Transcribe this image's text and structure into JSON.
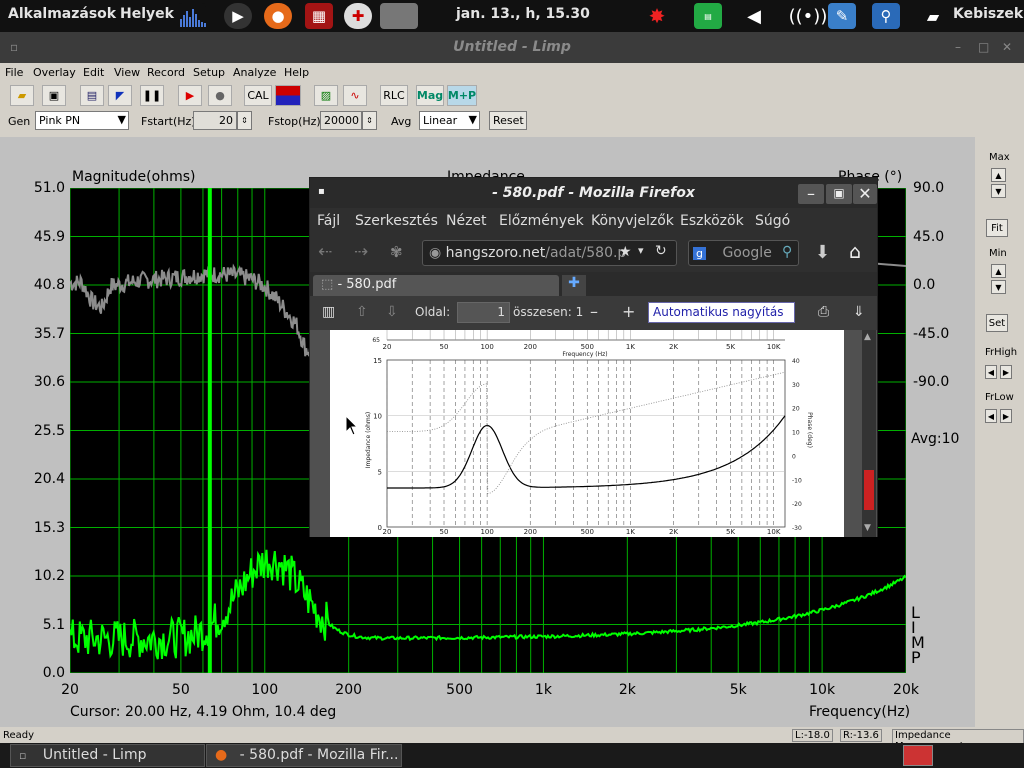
{
  "top_panel": {
    "apps": "Alkalmazások",
    "places": "Helyek",
    "clock": "jan. 13., h, 15.30",
    "user": "Kebiszek"
  },
  "limp": {
    "title": "Untitled - Limp",
    "menu": [
      "File",
      "Overlay",
      "Edit",
      "View",
      "Record",
      "Setup",
      "Analyze",
      "Help"
    ],
    "toolbar": {
      "cal": "CAL",
      "rlc": "RLC",
      "mag": "Mag",
      "mp": "M+P"
    },
    "params": {
      "gen_label": "Gen",
      "gen_value": "Pink PN",
      "fstart_label": "Fstart(Hz)",
      "fstart_value": "20",
      "fstop_label": "Fstop(Hz)",
      "fstop_value": "20000",
      "avg_label": "Avg",
      "avg_value": "Linear",
      "reset": "Reset"
    },
    "plot": {
      "ylabel": "Magnitude(ohms)",
      "title": "Impedance",
      "y2label": "Phase (°)",
      "yticks": [
        "51.0",
        "45.9",
        "40.8",
        "35.7",
        "30.6",
        "25.5",
        "20.4",
        "15.3",
        "10.2",
        "5.1",
        "0.0"
      ],
      "y2ticks": [
        "90.0",
        "45.0",
        "0.0",
        "-45.0",
        "-90.0"
      ],
      "xticks": [
        "20",
        "50",
        "100",
        "200",
        "500",
        "1k",
        "2k",
        "5k",
        "10k",
        "20k"
      ],
      "xlabel": "Frequency(Hz)",
      "cursor": "Cursor: 20.00 Hz, 4.19 Ohm, 10.4 deg",
      "avg": "Avg:10",
      "watermark": [
        "L",
        "I",
        "M",
        "P"
      ]
    },
    "right": {
      "max": "Max",
      "fit": "Fit",
      "min": "Min",
      "set": "Set",
      "frhigh": "FrHigh",
      "frlow": "FrLow"
    },
    "status": {
      "left": "Ready",
      "l": "L:-18.0",
      "r": "R:-13.6",
      "mode": "Impedance Measurement"
    }
  },
  "firefox": {
    "title": "- 580.pdf - Mozilla Firefox",
    "menu": [
      "Fájl",
      "Szerkesztés",
      "Nézet",
      "Előzmények",
      "Könyvjelzők",
      "Eszközök",
      "Súgó"
    ],
    "url_host": "hangszoro.net",
    "url_path": "/adat/580.p",
    "search_placeholder": "Google",
    "tab": "- 580.pdf",
    "page_label": "Oldal:",
    "page_value": "1",
    "total": "összesen: 1",
    "zoom": "Automatikus nagyítás",
    "pdf": {
      "top_xticks": [
        "20",
        "50",
        "100",
        "200",
        "500",
        "1K",
        "2K",
        "5K",
        "10K"
      ],
      "top_xlabel": "Frequency (Hz)",
      "top_ylabel": "65",
      "yticks": [
        "15",
        "10",
        "5",
        "0"
      ],
      "y2ticks": [
        "40",
        "30",
        "20",
        "10",
        "0",
        "-10",
        "-20",
        "-30"
      ],
      "xticks": [
        "20",
        "50",
        "100",
        "200",
        "500",
        "1K",
        "2K",
        "5K",
        "10K"
      ],
      "ylabel": "Impedance (ohms)",
      "y2label": "Phase (deg)"
    }
  },
  "taskbar": {
    "items": [
      "Untitled - Limp",
      "- 580.pdf - Mozilla Fir..."
    ]
  },
  "colors": {
    "magnitude": "#00ff00",
    "phase": "#8c8c8c",
    "grid": "#00b000",
    "cursor": "#00ff00"
  }
}
